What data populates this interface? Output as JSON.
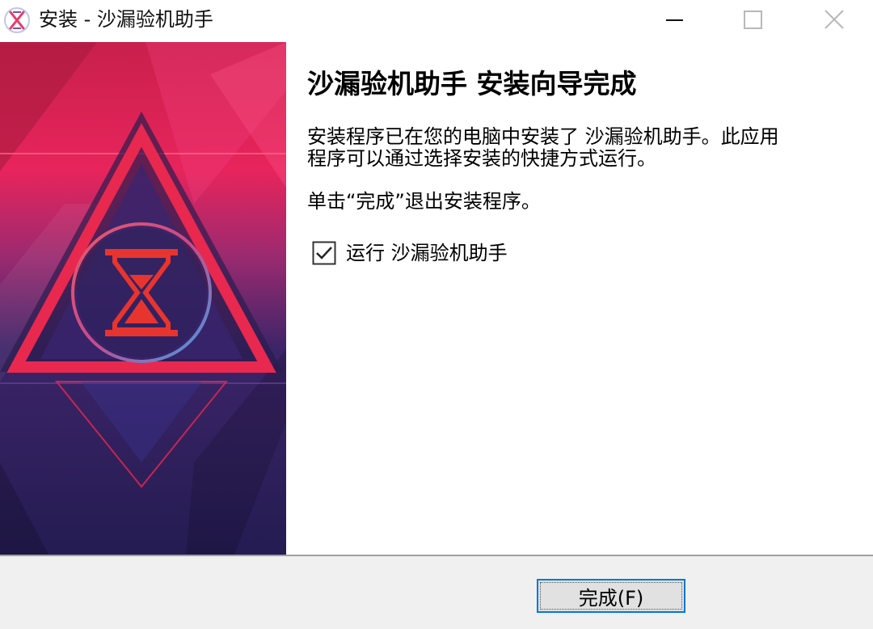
{
  "window": {
    "title": "安装 - 沙漏验机助手",
    "app_icon": "hourglass-x-icon",
    "minimize_icon": "minimize-icon",
    "maximize_icon": "maximize-icon",
    "close_icon": "close-icon"
  },
  "banner": {
    "icon": "hourglass-icon",
    "colors": {
      "top": "#e8245c",
      "bottom": "#2a2160",
      "triangle_outline": "#e8284f",
      "circle": "#3a8fd8"
    }
  },
  "content": {
    "heading": "沙漏验机助手  安装向导完成",
    "description_lines": [
      "安装程序已在您的电脑中安装了 沙漏验机助手。此应用",
      "程序可以通过选择安装的快捷方式运行。"
    ],
    "hint": "单击“完成”退出安装程序。",
    "run_checkbox": {
      "label": "运行 沙漏验机助手",
      "checked": true
    }
  },
  "footer": {
    "finish_label": "完成(F)"
  }
}
